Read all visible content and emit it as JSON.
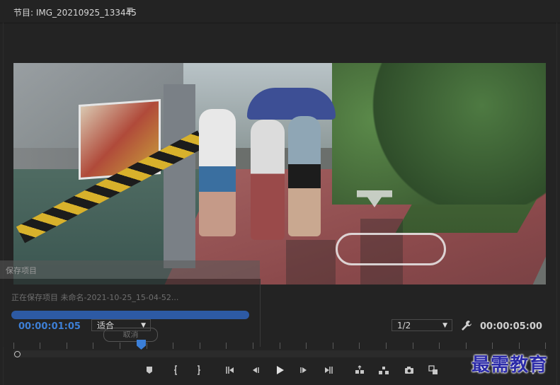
{
  "header": {
    "title": "节目: IMG_20210925_133445",
    "menu_icon": "hamburger-menu-icon"
  },
  "save_dialog": {
    "title": "保存项目",
    "status": "正在保存项目 未命名-2021-10-25_15-04-52...",
    "cancel_label": "取消"
  },
  "monitor": {
    "current_time": "00:00:01:05",
    "fit_label": "适合",
    "resolution_label": "1/2",
    "duration": "00:00:05:00"
  },
  "transport": {
    "buttons": [
      {
        "name": "add-marker-icon"
      },
      {
        "name": "mark-in-icon"
      },
      {
        "name": "mark-out-icon"
      },
      {
        "name": "go-to-in-icon"
      },
      {
        "name": "step-back-icon"
      },
      {
        "name": "play-icon"
      },
      {
        "name": "step-forward-icon"
      },
      {
        "name": "go-to-out-icon"
      },
      {
        "name": "lift-icon"
      },
      {
        "name": "extract-icon"
      },
      {
        "name": "export-frame-icon"
      },
      {
        "name": "comparison-view-icon"
      }
    ],
    "add_label": "+"
  },
  "watermark": {
    "text": "最需教育"
  },
  "colors": {
    "accent": "#3d7fd6",
    "watermark": "#2b2aa8"
  }
}
